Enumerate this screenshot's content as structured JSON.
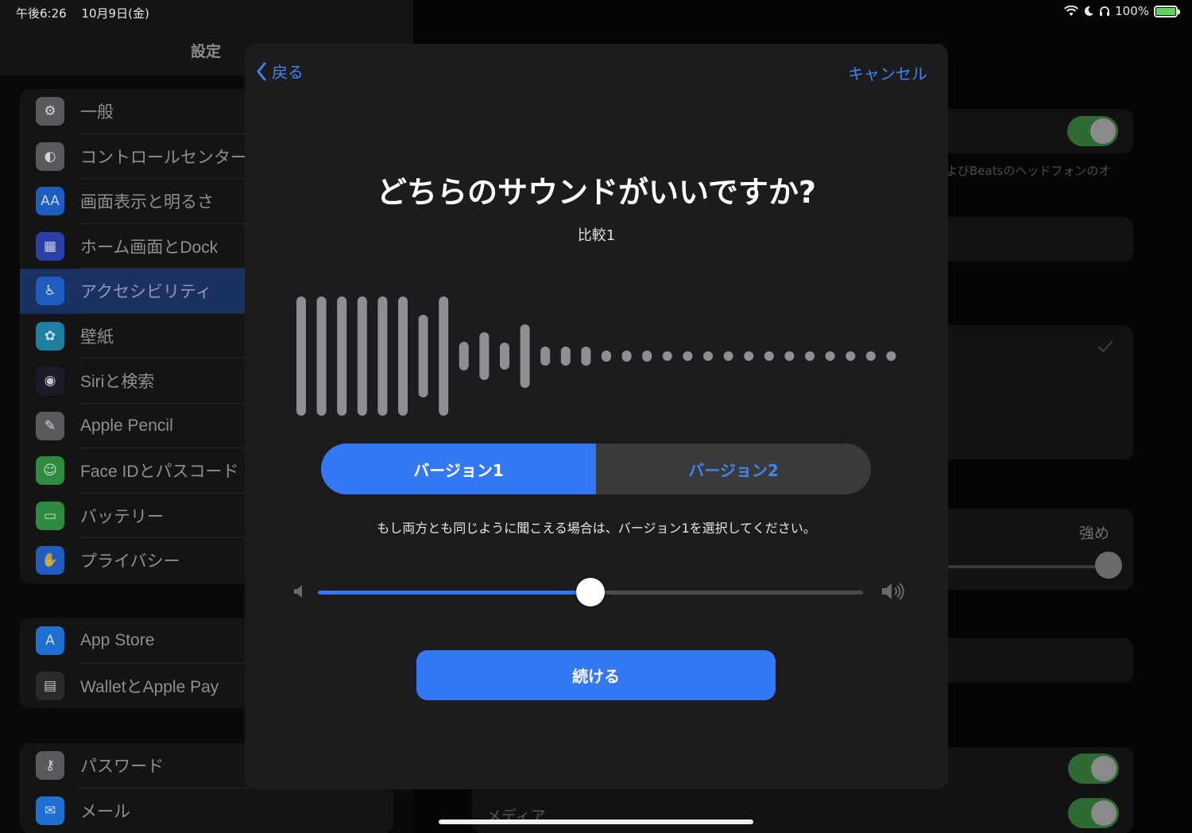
{
  "status_bar": {
    "time": "午後6:26",
    "date": "10月9日(金)",
    "battery": "100%",
    "battery_level": 1.0
  },
  "sidebar": {
    "title": "設定",
    "group1": [
      {
        "label": "一般",
        "icon": "gear-icon",
        "color": "#5a5a5e"
      },
      {
        "label": "コントロールセンター",
        "icon": "toggles-icon",
        "color": "#5a5a5e"
      },
      {
        "label": "画面表示と明るさ",
        "icon": "text-size-icon",
        "color": "#1f5cc0"
      },
      {
        "label": "ホーム画面とDock",
        "icon": "grid-icon",
        "color": "#2c3fa8"
      },
      {
        "label": "アクセシビリティ",
        "icon": "accessibility-icon",
        "color": "#1f5cc0",
        "selected": true
      },
      {
        "label": "壁紙",
        "icon": "flower-icon",
        "color": "#1e7fa0"
      },
      {
        "label": "Siriと検索",
        "icon": "siri-icon",
        "color": "#1a1a2a"
      },
      {
        "label": "Apple Pencil",
        "icon": "pencil-icon",
        "color": "#5a5a5e"
      },
      {
        "label": "Face IDとパスコード",
        "icon": "face-id-icon",
        "color": "#2d8a3e"
      },
      {
        "label": "バッテリー",
        "icon": "battery-icon",
        "color": "#2d8a3e"
      },
      {
        "label": "プライバシー",
        "icon": "hand-icon",
        "color": "#1f5cc0"
      }
    ],
    "group2": [
      {
        "label": "App Store",
        "icon": "app-store-icon",
        "color": "#1f6fd0"
      },
      {
        "label": "WalletとApple Pay",
        "icon": "wallet-icon",
        "color": "#2a2a2a"
      }
    ],
    "group3": [
      {
        "label": "パスワード",
        "icon": "key-icon",
        "color": "#5a5a5e"
      },
      {
        "label": "メール",
        "icon": "mail-icon",
        "color": "#1f6fd0"
      }
    ]
  },
  "detail": {
    "footnote": "よびBeatsのヘッドフォンのオ",
    "strength_label": "強め",
    "media_label": "メディア"
  },
  "modal": {
    "back_label": "戻る",
    "cancel_label": "キャンセル",
    "title": "どちらのサウンドがいいですか?",
    "subtitle": "比較1",
    "segment": {
      "option1": "バージョン1",
      "option2": "バージョン2",
      "selected": 1
    },
    "hint": "もし両方とも同じように聞こえる場合は、バージョン1を選択してください。",
    "volume": 0.5,
    "continue_label": "続ける",
    "accent_color": "#3478f6"
  }
}
